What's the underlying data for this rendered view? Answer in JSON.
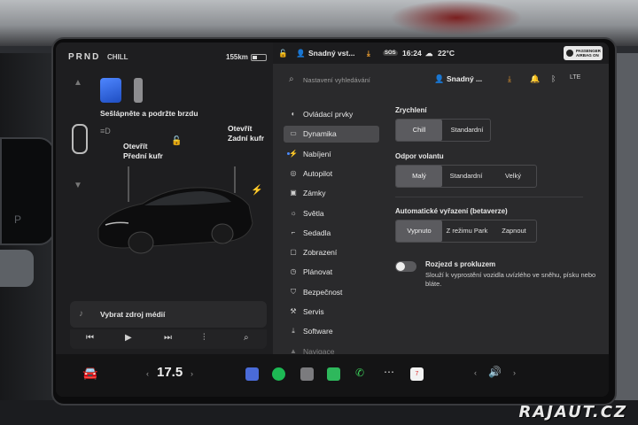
{
  "left_panel": {
    "gear": "PRND",
    "drive_mode": "CHILL",
    "range": "155km",
    "brake_message": "Sešlápněte a podržte brzdu",
    "gear_indicator": "P",
    "frunk_label_1": "Otevřít",
    "frunk_label_2": "Přední kufr",
    "trunk_label_1": "Otevřít",
    "trunk_label_2": "Zadní kufr",
    "media_source": "Vybrat zdroj médií"
  },
  "status_bar": {
    "profile": "Snadný vst...",
    "sos": "SOS",
    "time": "16:24",
    "temperature": "22°C",
    "passenger_airbag_1": "PASSENGER",
    "passenger_airbag_2": "AIRBAG ON"
  },
  "search": {
    "placeholder": "Nastavení vyhledávání",
    "profile": "Snadný ..."
  },
  "menu": [
    {
      "label": "Ovládací prvky",
      "icon": "toggle-icon"
    },
    {
      "label": "Dynamika",
      "icon": "car-icon"
    },
    {
      "label": "Nabíjení",
      "icon": "bolt-icon"
    },
    {
      "label": "Autopilot",
      "icon": "steering-wheel-icon"
    },
    {
      "label": "Zámky",
      "icon": "lock-icon"
    },
    {
      "label": "Světla",
      "icon": "sun-icon"
    },
    {
      "label": "Sedadla",
      "icon": "seat-icon"
    },
    {
      "label": "Zobrazení",
      "icon": "display-icon"
    },
    {
      "label": "Plánovat",
      "icon": "clock-icon"
    },
    {
      "label": "Bezpečnost",
      "icon": "shield-icon"
    },
    {
      "label": "Servis",
      "icon": "wrench-icon"
    },
    {
      "label": "Software",
      "icon": "download-icon"
    },
    {
      "label": "Navigace",
      "icon": "navigation-icon"
    }
  ],
  "settings": {
    "acceleration": {
      "title": "Zrychlení",
      "options": [
        "Chill",
        "Standardní"
      ],
      "selected": "Chill"
    },
    "steering": {
      "title": "Odpor volantu",
      "options": [
        "Malý",
        "Standardní",
        "Velký"
      ],
      "selected": "Malý"
    },
    "auto_shift": {
      "title": "Automatické vyřazení (betaverze)",
      "options": [
        "Vypnuto",
        "Z režimu Park",
        "Zapnout"
      ],
      "selected": "Vypnuto"
    },
    "creep": {
      "title": "Rozjezd s prokluzem",
      "description": "Slouží k vyprostění vozidla uvízlého ve sněhu, písku nebo bláte."
    }
  },
  "dock": {
    "temperature": "17.5",
    "calendar_day": "7"
  },
  "watermark": "RAJAUT.CZ"
}
